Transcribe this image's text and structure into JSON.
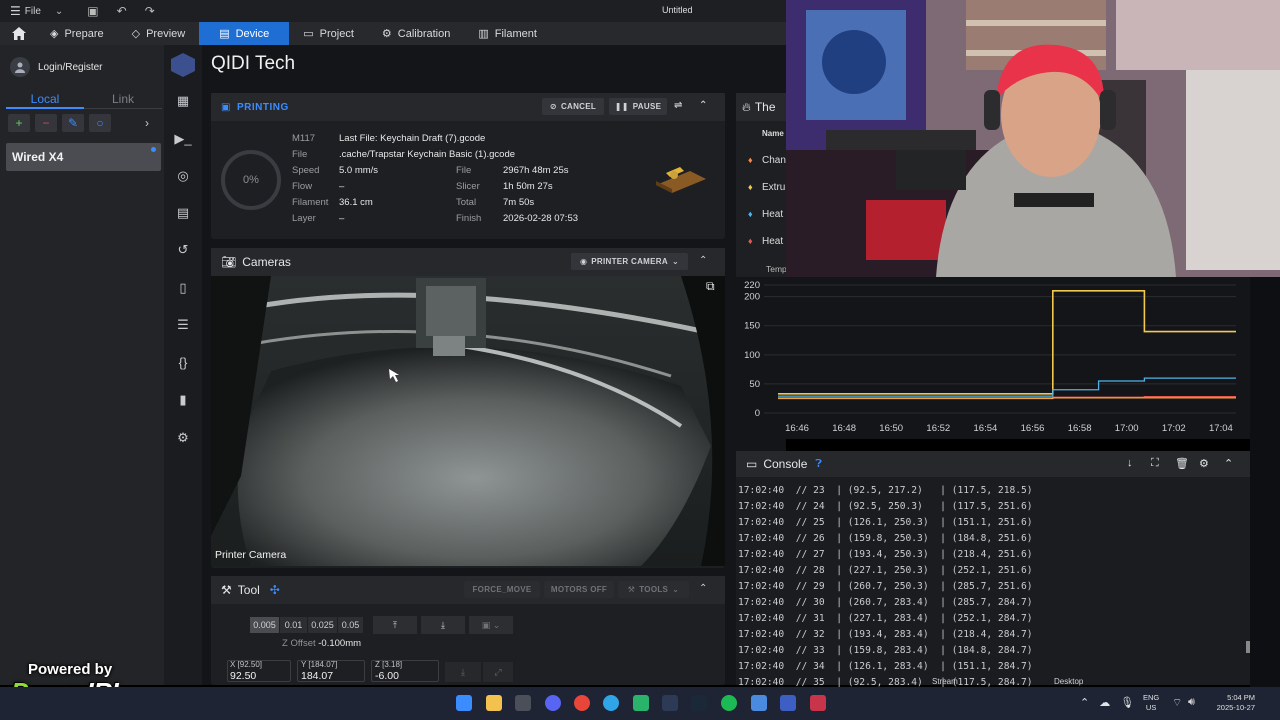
{
  "titlebar": {
    "file_label": "File",
    "title": "Untitled"
  },
  "menu": {
    "tabs": [
      "Prepare",
      "Preview",
      "Device",
      "Project",
      "Calibration",
      "Filament"
    ]
  },
  "left": {
    "login": "Login/Register",
    "tab_local": "Local",
    "tab_link": "Link",
    "printer_name": "Wired X4"
  },
  "page_title": "QIDI Tech",
  "printing": {
    "header": "PRINTING",
    "cancel_label": "CANCEL",
    "pause_label": "PAUSE",
    "progress": "0%",
    "rows": {
      "m117_label": "M117",
      "m117_value": "Last File: Keychain Draft (7).gcode",
      "file_label": "File",
      "file_value": ".cache/Trapstar Keychain Basic (1).gcode",
      "speed_label": "Speed",
      "speed_value": "5.0 mm/s",
      "flow_label": "Flow",
      "flow_value": "–",
      "filament_label": "Filament",
      "filament_value": "36.1 cm",
      "layer_label": "Layer",
      "layer_value": "–",
      "file2_label": "File",
      "file2_value": "2967h 48m 25s",
      "slicer_label": "Slicer",
      "slicer_value": "1h 50m 27s",
      "total_label": "Total",
      "total_value": "7m 50s",
      "finish_label": "Finish",
      "finish_value": "2026-02-28 07:53"
    }
  },
  "cameras": {
    "header": "Cameras",
    "selector": "PRINTER CAMERA",
    "overlay_label": "Printer Camera"
  },
  "tool": {
    "header": "Tool",
    "force_move": "FORCE_MOVE",
    "motors_off": "MOTORS OFF",
    "tools": "TOOLS",
    "steps": [
      "0.005",
      "0.01",
      "0.025",
      "0.05"
    ],
    "zoffset_label": "Z Offset",
    "zoffset_value": "-0.100mm",
    "x_label": "X [92.50]",
    "x_value": "92.50",
    "y_label": "Y [184.07]",
    "y_value": "184.07",
    "z_label": "Z [3.18]",
    "z_value": "-6.00"
  },
  "thermals": {
    "header": "The",
    "name_col": "Name",
    "rows": [
      "Chan",
      "Extru",
      "Heat",
      "Heat"
    ],
    "temp_col": "Temp"
  },
  "chart_data": {
    "type": "line",
    "x": [
      "16:46",
      "16:48",
      "16:50",
      "16:52",
      "16:54",
      "16:56",
      "16:58",
      "17:00",
      "17:02",
      "17:04"
    ],
    "yticks": [
      0,
      50,
      100,
      150,
      200,
      220
    ],
    "ylim": [
      0,
      220
    ],
    "series": [
      {
        "color": "#f2c94c",
        "values": [
          33,
          33,
          33,
          33,
          33,
          33,
          210,
          210,
          140,
          140,
          140
        ]
      },
      {
        "color": "#4fb3e8",
        "values": [
          29,
          29,
          29,
          29,
          29,
          29,
          40,
          55,
          60,
          60,
          60
        ]
      },
      {
        "color": "#e9584c",
        "values": [
          26,
          26,
          26,
          26,
          26,
          26,
          27,
          27,
          28,
          28,
          28
        ]
      },
      {
        "color": "#f0a33a",
        "values": [
          25,
          25,
          25,
          25,
          25,
          25,
          26,
          26,
          26,
          26,
          26
        ]
      }
    ]
  },
  "console": {
    "header": "Console",
    "lines": [
      "17:02:40  // 23  | (92.5, 217.2)   | (117.5, 218.5)",
      "17:02:40  // 24  | (92.5, 250.3)   | (117.5, 251.6)",
      "17:02:40  // 25  | (126.1, 250.3)  | (151.1, 251.6)",
      "17:02:40  // 26  | (159.8, 250.3)  | (184.8, 251.6)",
      "17:02:40  // 27  | (193.4, 250.3)  | (218.4, 251.6)",
      "17:02:40  // 28  | (227.1, 250.3)  | (252.1, 251.6)",
      "17:02:40  // 29  | (260.7, 250.3)  | (285.7, 251.6)",
      "17:02:40  // 30  | (260.7, 283.4)  | (285.7, 284.7)",
      "17:02:40  // 31  | (227.1, 283.4)  | (252.1, 284.7)",
      "17:02:40  // 32  | (193.4, 283.4)  | (218.4, 284.7)",
      "17:02:40  // 33  | (159.8, 283.4)  | (184.8, 284.7)",
      "17:02:40  // 34  | (126.1, 283.4)  | (151.1, 284.7)",
      "17:02:40  // 35  | (92.5, 283.4)   | (117.5, 284.7)"
    ]
  },
  "overlay": {
    "powered": "Powered by",
    "brand_a": "Power",
    "brand_b": "IRL",
    "stream_label": "Stream",
    "desktop_label": "Desktop"
  },
  "taskbar": {
    "lang_top": "ENG",
    "lang_bottom": "US",
    "time": "5:04 PM",
    "date": "2025-10-27"
  },
  "colors": {
    "accent": "#1f6ed4",
    "panel": "#1e1f23",
    "chart_bg": "#141518"
  }
}
